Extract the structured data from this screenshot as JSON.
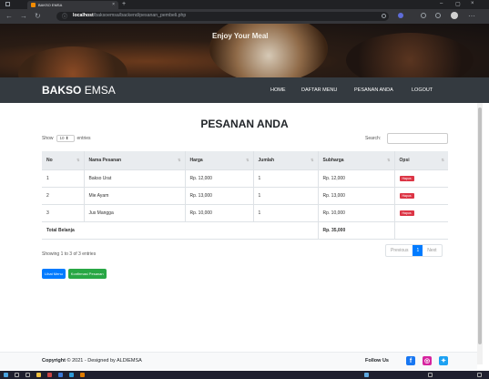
{
  "browser": {
    "tab_title": "BAKSO EMSA",
    "tab_close": "×",
    "new_tab": "+",
    "url_host": "localhost",
    "url_path": "/baksoemsa/backend/pesanan_pembeli.php",
    "win_min": "–",
    "win_max": "▢",
    "win_close": "×"
  },
  "hero": {
    "title": "Enjoy Your Meal"
  },
  "navbar": {
    "brand_bold": "BAKSO",
    "brand_rest": "EMSA",
    "items": [
      "HOME",
      "DAFTAR MENU",
      "PESANAN ANDA",
      "LOGOUT"
    ]
  },
  "main": {
    "heading": "PESANAN ANDA",
    "show_label": "Show",
    "show_value": "10",
    "entries_label": "entries",
    "search_label": "Search:",
    "columns": [
      "No",
      "Nama Pesanan",
      "Harga",
      "Jumlah",
      "Subharga",
      "Opsi"
    ],
    "rows": [
      {
        "no": "1",
        "nama": "Bakso Urat",
        "harga": "Rp. 12,000",
        "jumlah": "1",
        "subharga": "Rp. 12,000",
        "opsi": "Hapus"
      },
      {
        "no": "2",
        "nama": "Mie Ayam",
        "harga": "Rp. 13,000",
        "jumlah": "1",
        "subharga": "Rp. 13,000",
        "opsi": "Hapus"
      },
      {
        "no": "3",
        "nama": "Jus Mangga",
        "harga": "Rp. 10,000",
        "jumlah": "1",
        "subharga": "Rp. 10,000",
        "opsi": "Hapus"
      }
    ],
    "total_label": "Total Belanja",
    "total_value": "Rp. 35,000",
    "info": "Showing 1 to 3 of 3 entries",
    "pager": {
      "prev": "Previous",
      "page": "1",
      "next": "Next"
    },
    "btn_lihat": "Lihat Menu",
    "btn_konfirmasi": "Konfirmasi Pesanan"
  },
  "footer": {
    "copyright_label": "Copyright",
    "copyright_symbol": "©",
    "copyright_rest": "2021 - Designed by ALDIEMSA",
    "follow": "Follow Us",
    "social": [
      "facebook-icon",
      "instagram-icon",
      "twitter-icon"
    ]
  },
  "colors": {
    "navbar": "#343a40",
    "primary": "#007bff",
    "success": "#28a745",
    "danger": "#dc3545"
  }
}
